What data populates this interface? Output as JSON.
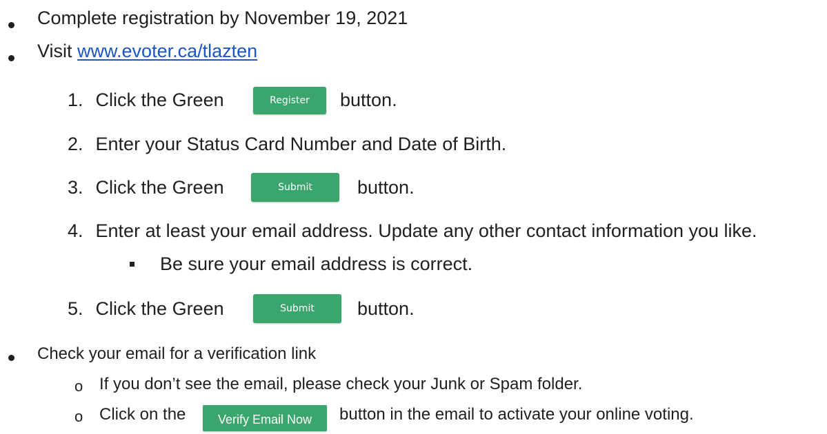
{
  "bullets": {
    "registration": "Complete registration by November 19, 2021",
    "visit_label": "Visit ",
    "visit_link": "www.evoter.ca/tlazten",
    "check_email": "Check your email for a verification link"
  },
  "steps": [
    {
      "number": "1.",
      "before": "Click the Green",
      "button": "Register",
      "after": "button."
    },
    {
      "number": "2.",
      "text": "Enter your Status Card Number and Date of Birth."
    },
    {
      "number": "3.",
      "before": "Click the Green",
      "button": "Submit",
      "after": "button."
    },
    {
      "number": "4.",
      "text": "Enter at least your email address. Update any other contact information you like."
    },
    {
      "number": "5.",
      "before": "Click the Green",
      "button": "Submit",
      "after": "button."
    }
  ],
  "sub_bullet": "Be sure your email address is correct.",
  "email_notes": {
    "spam": "If you don’t see the email, please check your Junk or Spam folder.",
    "verify_before": "Click on the",
    "verify_button": "Verify Email Now",
    "verify_after": "button in the email to activate your online voting."
  },
  "o_marker": "o",
  "colors": {
    "button_green": "#3aa56c",
    "link_blue": "#1a56c4",
    "text": "#1f1f1f"
  }
}
